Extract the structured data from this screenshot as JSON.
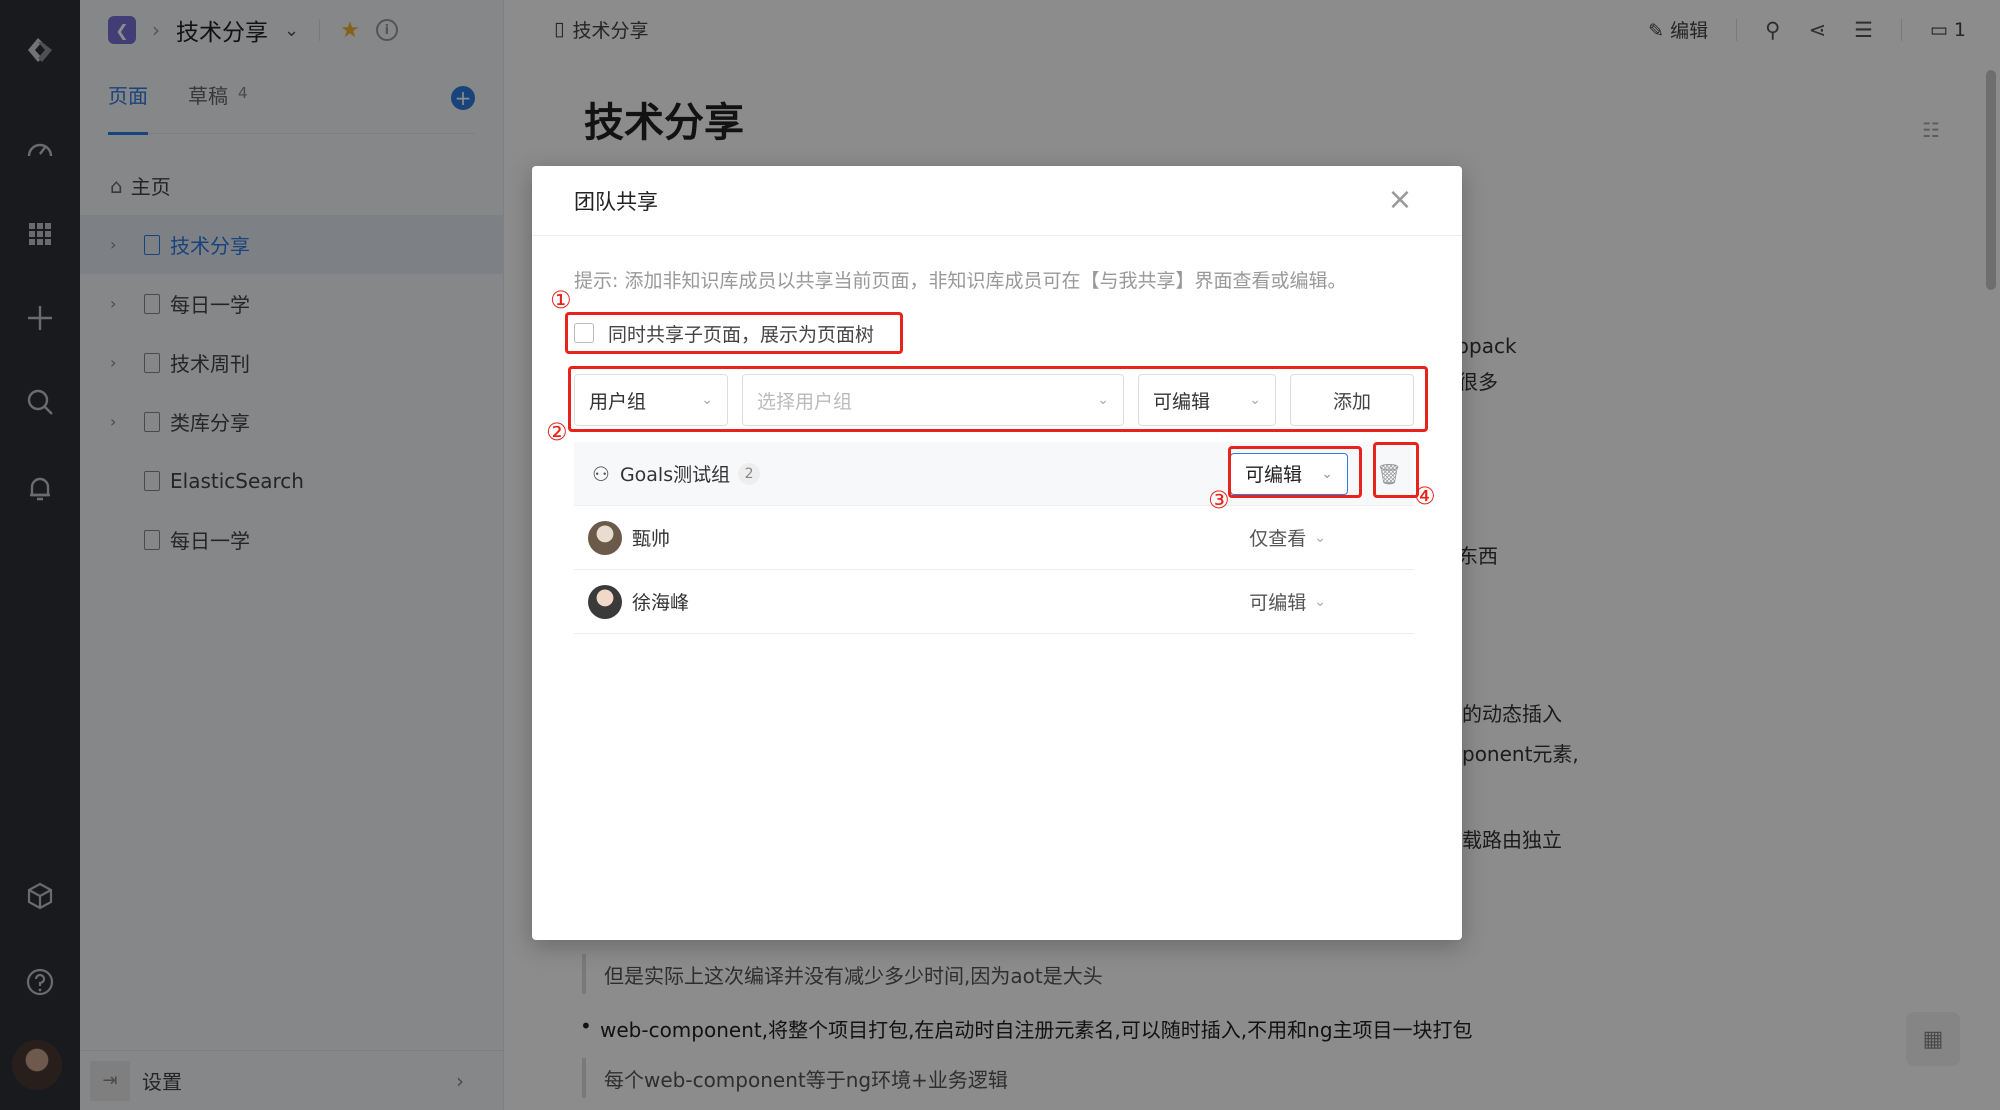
{
  "sidebar": {
    "kb_title": "技术分享",
    "tabs": [
      {
        "label": "页面"
      },
      {
        "label": "草稿",
        "count": "4"
      }
    ],
    "tree": [
      {
        "label": "主页"
      },
      {
        "label": "技术分享"
      },
      {
        "label": "每日一学"
      },
      {
        "label": "技术周刊"
      },
      {
        "label": "类库分享"
      },
      {
        "label": "ElasticSearch"
      },
      {
        "label": "每日一学"
      }
    ],
    "footer_label": "设置"
  },
  "main": {
    "doc_crumb": "技术分享",
    "edit_label": "编辑",
    "comment_count": "1",
    "page_title": "技术分享",
    "fragments": [
      "ebpack",
      "很多",
      "东西",
      "的动态插入",
      "ponent元素,",
      "载路由独立"
    ],
    "quote1": "但是实际上这次编译并没有减少多少时间,因为aot是大头",
    "bullet1": "web-component,将整个项目打包,在启动时自注册元素名,可以随时插入,不用和ng主项目一块打包",
    "quote2": "每个web-component等于ng环境+业务逻辑"
  },
  "modal": {
    "title": "团队共享",
    "hint": "提示: 添加非知识库成员以共享当前页面，非知识库成员可在【与我共享】界面查看或编辑。",
    "share_children_label": "同时共享子页面，展示为页面树",
    "type_select": "用户组",
    "group_placeholder": "选择用户组",
    "perm_select": "可编辑",
    "add_button": "添加",
    "members": [
      {
        "name": "Goals测试组",
        "count": "2",
        "perm": "可编辑",
        "type": "group"
      },
      {
        "name": "甄帅",
        "perm": "仅查看",
        "type": "user"
      },
      {
        "name": "徐海峰",
        "perm": "可编辑",
        "type": "user"
      }
    ]
  },
  "annotations": {
    "n1": "①",
    "n2": "②",
    "n3": "③",
    "n4": "④",
    "color": "#e8231b"
  },
  "colors": {
    "accent": "#2f7be0",
    "rail": "#2d3035",
    "star": "#f0b330"
  }
}
